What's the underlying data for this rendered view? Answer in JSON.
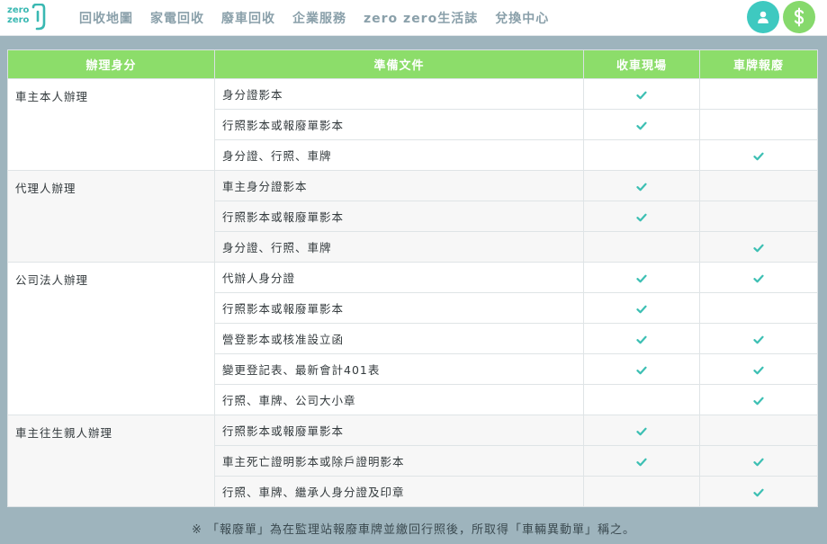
{
  "nav": {
    "logo_line1": "zero",
    "logo_line2": "zero",
    "items": [
      "回收地圖",
      "家電回收",
      "廢車回收",
      "企業服務",
      "zero zero生活誌",
      "兌換中心"
    ]
  },
  "table": {
    "headers": [
      "辦理身分",
      "準備文件",
      "收車現場",
      "車牌報廢"
    ],
    "groups": [
      {
        "identity": "車主本人辦理",
        "rows": [
          {
            "doc": "身分證影本",
            "on_site": true,
            "plate_scrap": false
          },
          {
            "doc": "行照影本或報廢單影本",
            "on_site": true,
            "plate_scrap": false
          },
          {
            "doc": "身分證、行照、車牌",
            "on_site": false,
            "plate_scrap": true
          }
        ]
      },
      {
        "identity": "代理人辦理",
        "rows": [
          {
            "doc": "車主身分證影本",
            "on_site": true,
            "plate_scrap": false
          },
          {
            "doc": "行照影本或報廢單影本",
            "on_site": true,
            "plate_scrap": false
          },
          {
            "doc": "身分證、行照、車牌",
            "on_site": false,
            "plate_scrap": true
          }
        ]
      },
      {
        "identity": "公司法人辦理",
        "rows": [
          {
            "doc": "代辦人身分證",
            "on_site": true,
            "plate_scrap": true
          },
          {
            "doc": "行照影本或報廢單影本",
            "on_site": true,
            "plate_scrap": false
          },
          {
            "doc": "營登影本或核准設立函",
            "on_site": true,
            "plate_scrap": true
          },
          {
            "doc": "變更登記表、最新會計401表",
            "on_site": true,
            "plate_scrap": true
          },
          {
            "doc": "行照、車牌、公司大小章",
            "on_site": false,
            "plate_scrap": true
          }
        ]
      },
      {
        "identity": "車主往生親人辦理",
        "rows": [
          {
            "doc": "行照影本或報廢單影本",
            "on_site": true,
            "plate_scrap": false
          },
          {
            "doc": "車主死亡證明影本或除戶證明影本",
            "on_site": true,
            "plate_scrap": true
          },
          {
            "doc": "行照、車牌、繼承人身分證及印章",
            "on_site": false,
            "plate_scrap": true
          }
        ]
      }
    ]
  },
  "footnote": "※ 「報廢單」為在監理站報廢車牌並繳回行照後，所取得「車輛異動單」稱之。",
  "colors": {
    "header_green": "#8cdd6a",
    "check_teal": "#3cbfb3",
    "user_button": "#3ec9c0",
    "money_button": "#86d96c",
    "page_bg": "#9eb4bd"
  },
  "icons": {
    "user_button": "user-icon",
    "money_button": "dollar-icon",
    "check": "check-icon"
  }
}
